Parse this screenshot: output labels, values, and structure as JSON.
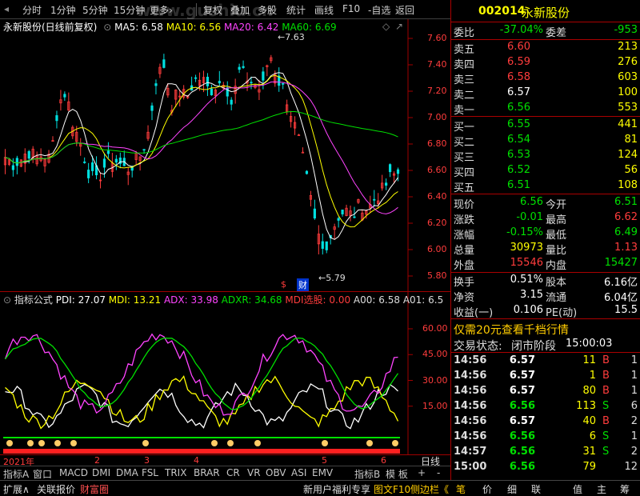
{
  "toolbar": {
    "items": [
      "分时",
      "1分钟",
      "5分钟",
      "15分钟",
      "更多›",
      "复权",
      "叠加",
      "多股",
      "统计",
      "画线",
      "F10",
      "-自选",
      "返回"
    ],
    "watermark": "www.gushiu.cn"
  },
  "chart_header": {
    "stock": "永新股份(日线前复权)",
    "ma5": "MA5: 6.58",
    "ma10": "MA10: 6.56",
    "ma20": "MA20: 6.42",
    "ma60": "MA60: 6.69"
  },
  "price_axis": [
    "7.60",
    "7.40",
    "7.20",
    "7.00",
    "6.80",
    "6.60",
    "6.40",
    "6.20",
    "6.00",
    "5.80"
  ],
  "annotations": {
    "high": "7.63",
    "low": "5.79",
    "badge1": "$",
    "badge2": "财"
  },
  "indicator_header": {
    "name": "指标公式",
    "pdi": "PDI: 27.07",
    "mdi": "MDI: 13.21",
    "adx": "ADX: 33.98",
    "adxr": "ADXR: 34.68",
    "mdi_pick": "MDI选股: 0.00",
    "a00": "A00: 6.58",
    "a01": "A01: 6.5"
  },
  "indicator_axis": [
    "60.00",
    "45.00",
    "30.00",
    "15.00"
  ],
  "time_axis": {
    "year": "2021年",
    "months": [
      "2",
      "3",
      "4",
      "5",
      "6"
    ],
    "right_label": "日线"
  },
  "indicator_tabs": [
    "指标A",
    "窗口",
    "MACD",
    "DMI",
    "DMA",
    "FSL",
    "TRIX",
    "BRAR",
    "CR",
    "VR",
    "OBV",
    "ASI",
    "EMV",
    "指标B",
    "模 板",
    "+",
    "-"
  ],
  "quote": {
    "code": "002014",
    "name": "永新股份",
    "weibi_label": "委比",
    "weibi": "-37.04%",
    "weicha_label": "委差",
    "weicha": "-953",
    "asks": [
      {
        "label": "卖五",
        "price": "6.60",
        "vol": "213"
      },
      {
        "label": "卖四",
        "price": "6.59",
        "vol": "276"
      },
      {
        "label": "卖三",
        "price": "6.58",
        "vol": "603"
      },
      {
        "label": "卖二",
        "price": "6.57",
        "vol": "100"
      },
      {
        "label": "卖一",
        "price": "6.56",
        "vol": "553"
      }
    ],
    "bids": [
      {
        "label": "买一",
        "price": "6.55",
        "vol": "441"
      },
      {
        "label": "买二",
        "price": "6.54",
        "vol": "81"
      },
      {
        "label": "买三",
        "price": "6.53",
        "vol": "124"
      },
      {
        "label": "买四",
        "price": "6.52",
        "vol": "56"
      },
      {
        "label": "买五",
        "price": "6.51",
        "vol": "108"
      }
    ],
    "stats": [
      {
        "l1": "现价",
        "v1": "6.56",
        "l2": "今开",
        "v2": "6.51"
      },
      {
        "l1": "涨跌",
        "v1": "-0.01",
        "l2": "最高",
        "v2": "6.62"
      },
      {
        "l1": "涨幅",
        "v1": "-0.15%",
        "l2": "最低",
        "v2": "6.49"
      },
      {
        "l1": "总量",
        "v1": "30973",
        "l2": "量比",
        "v2": "1.13"
      },
      {
        "l1": "外盘",
        "v1": "15546",
        "l2": "内盘",
        "v2": "15427"
      }
    ],
    "stats2": [
      {
        "l1": "换手",
        "v1": "0.51%",
        "l2": "股本",
        "v2": "6.16亿"
      },
      {
        "l1": "净资",
        "v1": "3.15",
        "l2": "流通",
        "v2": "6.04亿"
      },
      {
        "l1": "收益(一)",
        "v1": "0.106",
        "l2": "PE(动)",
        "v2": "15.5"
      }
    ],
    "promo": "仅需20元查看千档行情",
    "status_label": "交易状态:",
    "status": "闭市阶段",
    "status_time": "15:00:03"
  },
  "ticks": [
    {
      "t": "14:56",
      "p": "6.57",
      "v": "11",
      "d": "B",
      "n": "1"
    },
    {
      "t": "14:56",
      "p": "6.57",
      "v": "1",
      "d": "B",
      "n": "1"
    },
    {
      "t": "14:56",
      "p": "6.57",
      "v": "80",
      "d": "B",
      "n": "1"
    },
    {
      "t": "14:56",
      "p": "6.56",
      "v": "113",
      "d": "S",
      "n": "6"
    },
    {
      "t": "14:56",
      "p": "6.57",
      "v": "40",
      "d": "B",
      "n": "2"
    },
    {
      "t": "14:56",
      "p": "6.56",
      "v": "6",
      "d": "S",
      "n": "1"
    },
    {
      "t": "14:57",
      "p": "6.56",
      "v": "31",
      "d": "S",
      "n": "2"
    },
    {
      "t": "15:00",
      "p": "6.56",
      "v": "79",
      "d": "",
      "n": "12"
    }
  ],
  "statusbar": {
    "left": [
      "扩展∧",
      "关联报价",
      "财富圈"
    ],
    "promo": "新用户福利专享",
    "f10": "图文F10",
    "side": "侧边栏《",
    "right": [
      "笔",
      "价",
      "细",
      "联",
      "值",
      "主",
      "筹"
    ]
  },
  "colors": {
    "up": "#ff3c3c",
    "down": "#00e000",
    "ma5": "#ffffff",
    "ma10": "#ffff00",
    "ma20": "#ff44ff",
    "ma60": "#00e000",
    "axis": "#ff3c3c",
    "frame": "#a00000"
  }
}
